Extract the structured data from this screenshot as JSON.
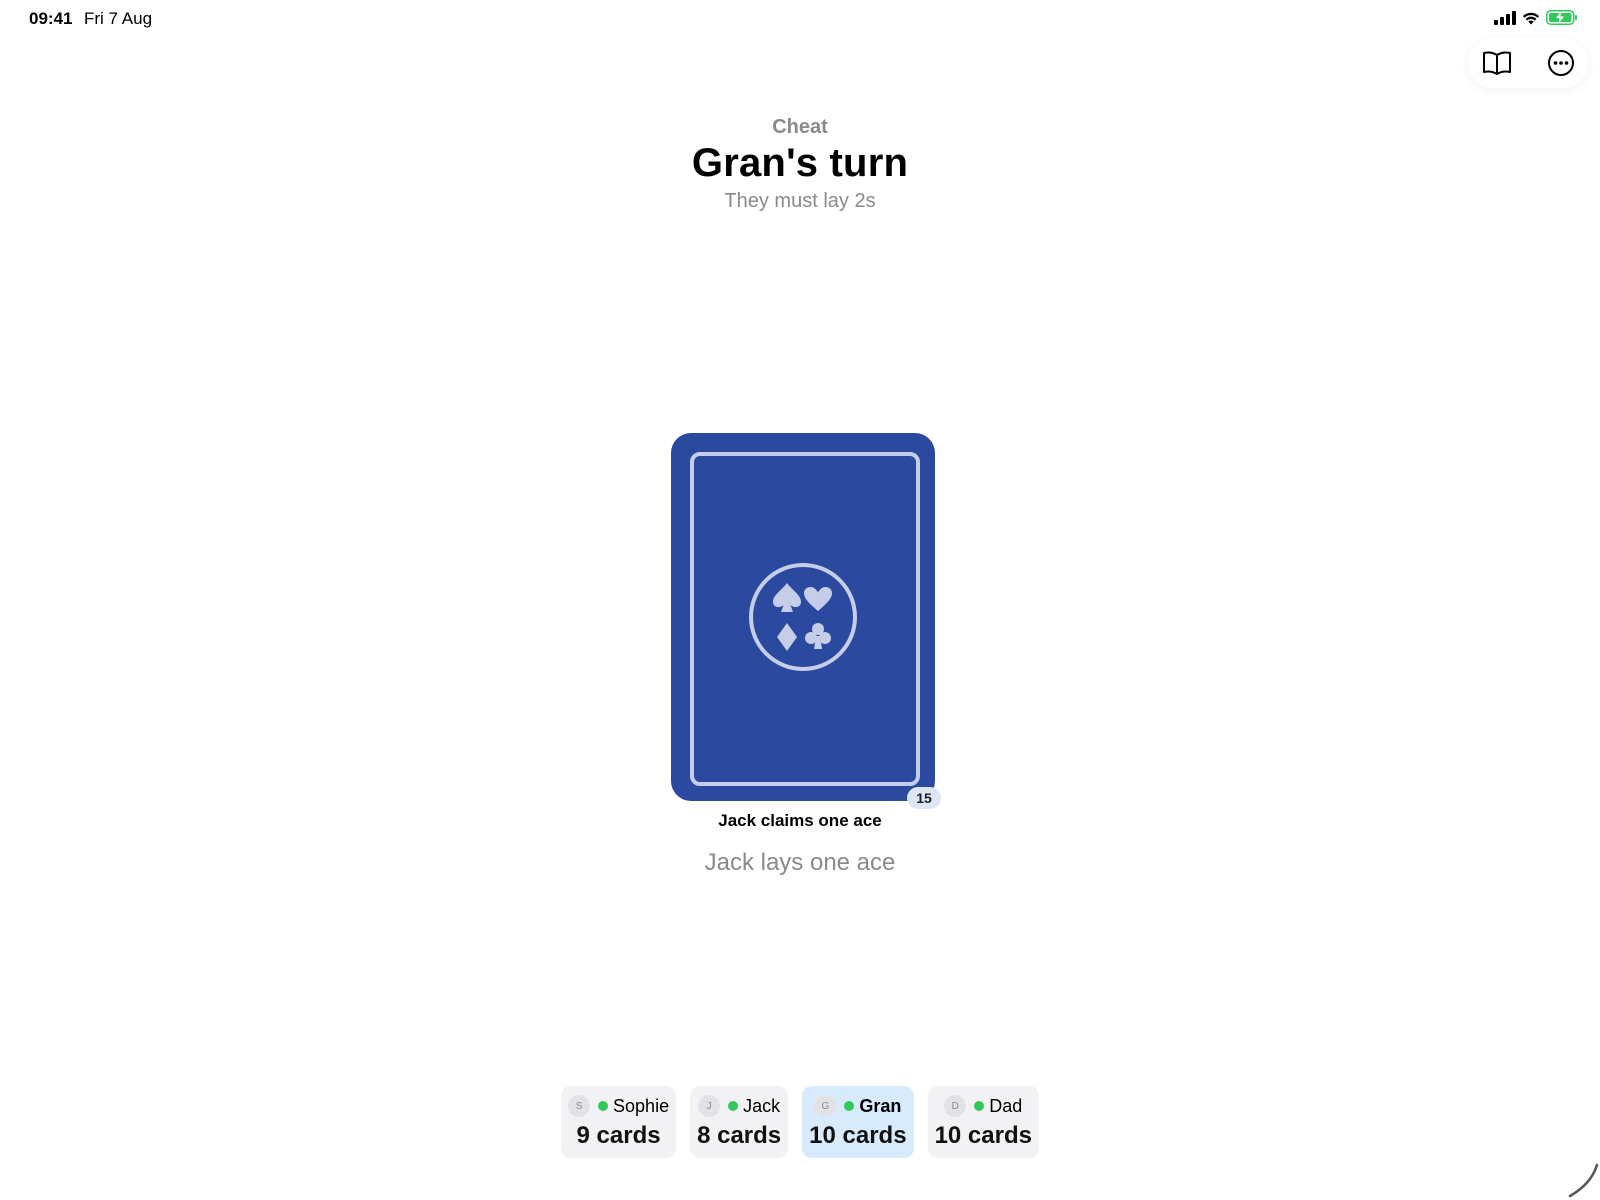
{
  "status_bar": {
    "time": "09:41",
    "date": "Fri 7 Aug"
  },
  "toolbar": {
    "rules_icon": "book-icon",
    "more_icon": "ellipsis-circle-icon"
  },
  "header": {
    "game_name": "Cheat",
    "turn_title": "Gran's turn",
    "turn_subtitle": "They must lay 2s"
  },
  "pile": {
    "card_back_color": "#2b4a9f",
    "count": "15",
    "claim": "Jack claims one ace",
    "last_action": "Jack lays one ace"
  },
  "players": [
    {
      "initial": "S",
      "name": "Sophie",
      "cards": "9 cards",
      "active": false
    },
    {
      "initial": "J",
      "name": "Jack",
      "cards": "8 cards",
      "active": false
    },
    {
      "initial": "G",
      "name": "Gran",
      "cards": "10 cards",
      "active": true
    },
    {
      "initial": "D",
      "name": "Dad",
      "cards": "10 cards",
      "active": false
    }
  ],
  "colors": {
    "accent_online": "#34c759",
    "active_player_bg": "#d8ebfd",
    "battery": "#34c759"
  }
}
